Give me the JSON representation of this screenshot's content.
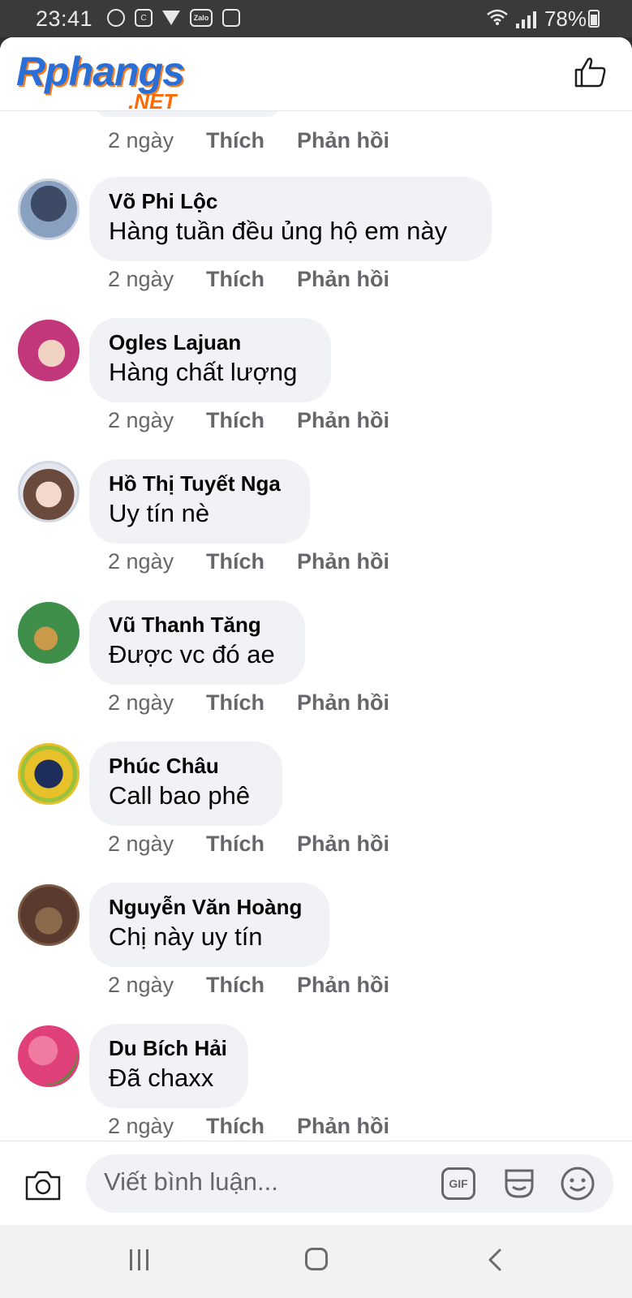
{
  "status_bar": {
    "time": "23:41",
    "battery": "78%",
    "zalo_label": "Zalo",
    "icons": [
      "shield-icon",
      "app-c-icon",
      "vpn-icon",
      "zalo-icon",
      "gallery-icon",
      "wifi-icon",
      "signal-icon",
      "battery-charging-icon"
    ]
  },
  "header": {
    "logo_main": "Rphangs",
    "logo_sub": ".NET",
    "like_icon": "thumbs-up-icon"
  },
  "top_actions": {
    "time": "2 ngày",
    "like": "Thích",
    "reply": "Phản hồi"
  },
  "comments": [
    {
      "name": "Võ Phi Lộc",
      "text": "Hàng tuần đều ủng hộ em này",
      "time": "2 ngày",
      "like": "Thích",
      "reply": "Phản hồi",
      "avatar_color": "#3d4a66"
    },
    {
      "name": "Ogles Lajuan",
      "text": "Hàng chất lượng",
      "time": "2 ngày",
      "like": "Thích",
      "reply": "Phản hồi",
      "avatar_color": "#c2367a"
    },
    {
      "name": "Hồ Thị Tuyết Nga",
      "text": "Uy tín nè",
      "time": "2 ngày",
      "like": "Thích",
      "reply": "Phản hồi",
      "avatar_color": "#d9a98f"
    },
    {
      "name": "Vũ Thanh Tăng",
      "text": "Được vc đó ae",
      "time": "2 ngày",
      "like": "Thích",
      "reply": "Phản hồi",
      "avatar_color": "#3f8f4a"
    },
    {
      "name": "Phúc Châu",
      "text": "Call bao phê",
      "time": "2 ngày",
      "like": "Thích",
      "reply": "Phản hồi",
      "avatar_color": "#9ac23a"
    },
    {
      "name": "Nguyễn Văn Hoàng",
      "text": "Chị này uy tín",
      "time": "2 ngày",
      "like": "Thích",
      "reply": "Phản hồi",
      "avatar_color": "#5a3a2e"
    },
    {
      "name": "Du Bích Hải",
      "text": "Đã chaxx",
      "time": "2 ngày",
      "like": "Thích",
      "reply": "Phản hồi",
      "avatar_color": "#e0407a"
    }
  ],
  "composer": {
    "placeholder": "Viết bình luận...",
    "gif_label": "GIF"
  },
  "colors": {
    "bubble": "#f0f2f5",
    "meta_text": "#65676b",
    "brand_blue": "#2a6fd6",
    "brand_orange": "#ff6a00"
  }
}
